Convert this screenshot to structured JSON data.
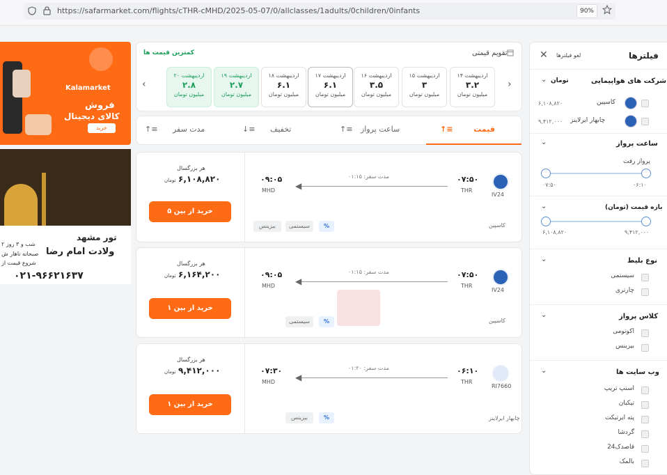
{
  "browser": {
    "url": "https://safarmarket.com/flights/cTHR-cMHD/2025-05-07/0/allclasses/1adults/0children/0infants",
    "zoom": "90%"
  },
  "ads": {
    "kala": {
      "brand": "Kalamarket",
      "line1": "فروش",
      "line2": "کالای دیجیتال",
      "cta": "خرید"
    },
    "tour": {
      "title": "تور مشهد",
      "subtitle": "ولادت امام رضا",
      "b1": "۲ شب و ۳ روز",
      "b2": "صبحانه ناهار ش",
      "b3": "شروع قیمت از",
      "phone": "۰۲۱-۹۶۶۲۱۶۳۷"
    }
  },
  "calendar": {
    "title": "تقویم قیمتی",
    "cheapest": "کمترین قیمت ها",
    "days": [
      {
        "date": "۱۴ اردیبهشت",
        "price": "۳.۲",
        "unit": "میلیون تومان"
      },
      {
        "date": "۱۵ اردیبهشت",
        "price": "۳",
        "unit": "میلیون تومان"
      },
      {
        "date": "۱۶ اردیبهشت",
        "price": "۳.۵",
        "unit": "میلیون تومان"
      },
      {
        "date": "۱۷ اردیبهشت",
        "price": "۶.۱",
        "unit": "میلیون تومان"
      },
      {
        "date": "۱۸ اردیبهشت",
        "price": "۶.۱",
        "unit": "میلیون تومان"
      },
      {
        "date": "۱۹ اردیبهشت",
        "price": "۲.۷",
        "unit": "میلیون تومان"
      },
      {
        "date": "۲۰ اردیبهشت",
        "price": "۲.۸",
        "unit": "میلیون تومان"
      }
    ]
  },
  "sort": {
    "price": "قیمت",
    "time": "ساعت پرواز",
    "discount": "تخفیف",
    "duration": "مدت سفر"
  },
  "flights": [
    {
      "code": "IV24",
      "airline": "کاسپین",
      "dep": "۰۷:۵۰",
      "dep_ap": "THR",
      "arr": "۰۹:۰۵",
      "arr_ap": "MHD",
      "duration": "مدت سفر: ۰۱:۱۵",
      "tags": [
        "سیستمی",
        "بیزینس"
      ],
      "per": "هر بزرگسال",
      "price": "۶,۱۰۸,۸۲۰",
      "unit": "تومان",
      "cta": "خرید از بین ۵ وبسایت"
    },
    {
      "code": "IV24",
      "airline": "کاسپین",
      "dep": "۰۷:۵۰",
      "dep_ap": "THR",
      "arr": "۰۹:۰۵",
      "arr_ap": "MHD",
      "duration": "مدت سفر: ۰۱:۱۵",
      "tags": [
        "سیستمی"
      ],
      "per": "هر بزرگسال",
      "price": "۶,۱۶۴,۲۰۰",
      "unit": "تومان",
      "cta": "خرید از بین ۱ وبسایت"
    },
    {
      "code": "RI7660",
      "airline": "چابهار ایرلاینز",
      "dep": "۰۶:۱۰",
      "dep_ap": "THR",
      "arr": "۰۷:۳۰",
      "arr_ap": "MHD",
      "duration": "مدت سفر: ۰۱:۲۰",
      "tags": [
        "بیزینس"
      ],
      "per": "هر بزرگسال",
      "price": "۹,۴۱۲,۰۰۰",
      "unit": "تومان",
      "cta": "خرید از بین ۱ وبسایت"
    }
  ],
  "filters": {
    "title": "فیلترها",
    "clear": "لغو فیلترها",
    "airlines": {
      "title": "شرکت های هواپیمایی",
      "unit": "تومان",
      "items": [
        {
          "name": "کاسپین",
          "price": "۶,۱۰۸,۸۲۰"
        },
        {
          "name": "چابهار ایرلاینز",
          "price": "۹,۴۱۲,۰۰۰"
        }
      ]
    },
    "time": {
      "title": "ساعت پرواز",
      "sub": "پرواز رفت",
      "min": "۰۶:۱۰",
      "max": "۰۷:۵۰"
    },
    "price": {
      "title": "بازه قیمت (تومان)",
      "min": "۶,۱۰۸,۸۲۰",
      "max": "۹,۴۱۲,۰۰۰"
    },
    "ticket": {
      "title": "نوع بلیط",
      "items": [
        "سیستمی",
        "چارتری"
      ]
    },
    "class": {
      "title": "کلاس پرواز",
      "items": [
        "اکونومی",
        "بیزینس"
      ]
    },
    "sites": {
      "title": "وب سایت ها",
      "items": [
        "اسنپ تریپ",
        "تیکبان",
        "پته ایرتیکت",
        "گردشا",
        "قاصدک24",
        "بالمک"
      ]
    }
  }
}
